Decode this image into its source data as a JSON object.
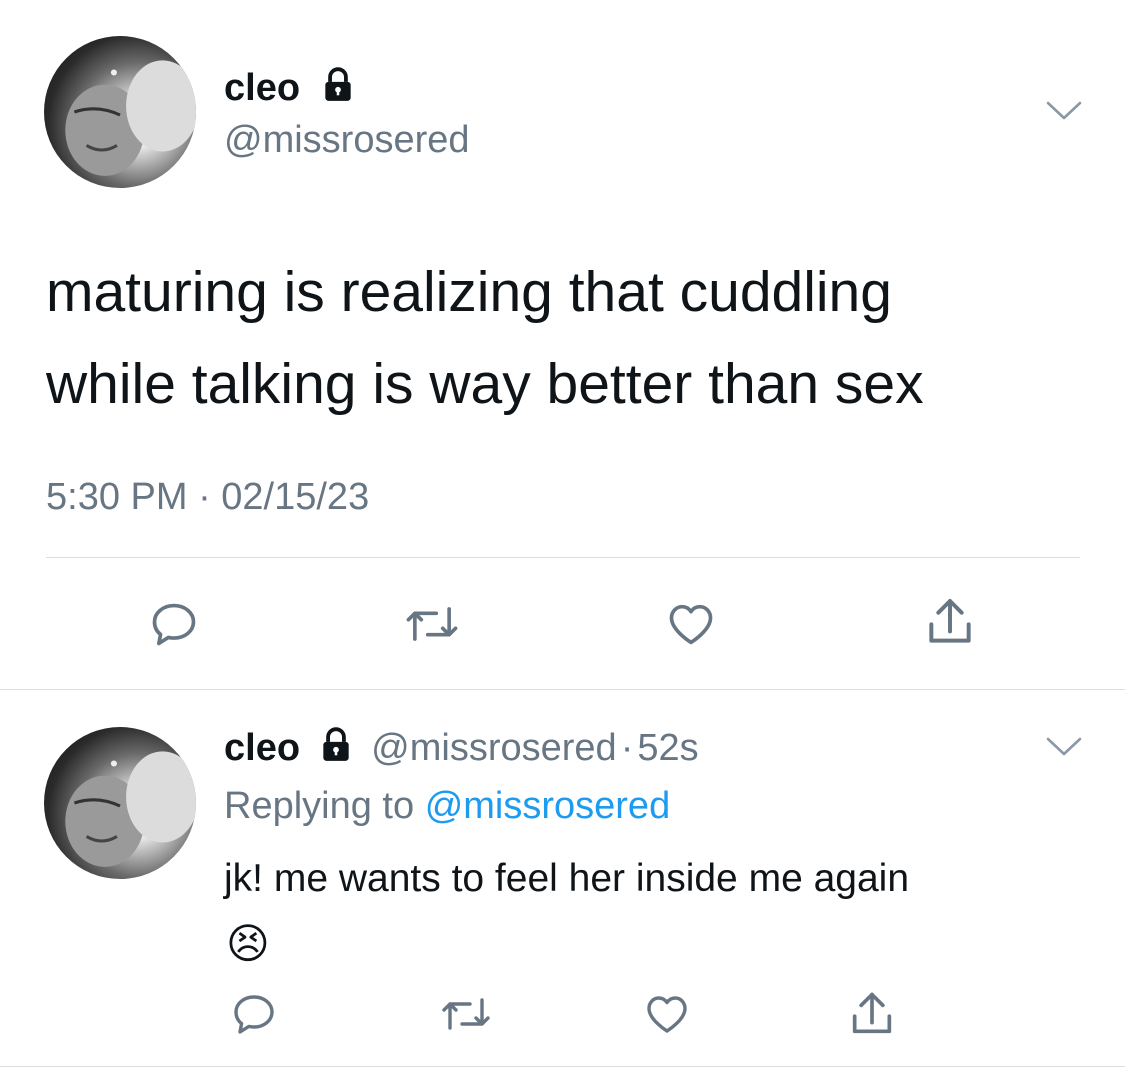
{
  "tweet": {
    "author": {
      "name": "cleo",
      "handle": "@missrosered",
      "protected_icon": "lock-icon"
    },
    "text_line1": "maturing is realizing that cuddling",
    "text_line2": "while talking is way better than sex",
    "timestamp": "5:30 PM · 02/15/23",
    "actions": [
      "reply-icon",
      "retweet-icon",
      "like-icon",
      "share-icon"
    ]
  },
  "reply": {
    "author": {
      "name": "cleo",
      "handle": "@missrosered",
      "protected_icon": "lock-icon"
    },
    "separator": "·",
    "age": "52s",
    "replying_prefix": "Replying to",
    "replying_handle": "@missrosered",
    "text": "jk! me wants to feel her inside me again",
    "emoji": "😣",
    "actions": [
      "reply-icon",
      "retweet-icon",
      "like-icon",
      "share-icon"
    ]
  },
  "colors": {
    "text": "#0f1419",
    "muted": "#687684",
    "link": "#1d9bf0",
    "divider": "#d9dde1"
  }
}
